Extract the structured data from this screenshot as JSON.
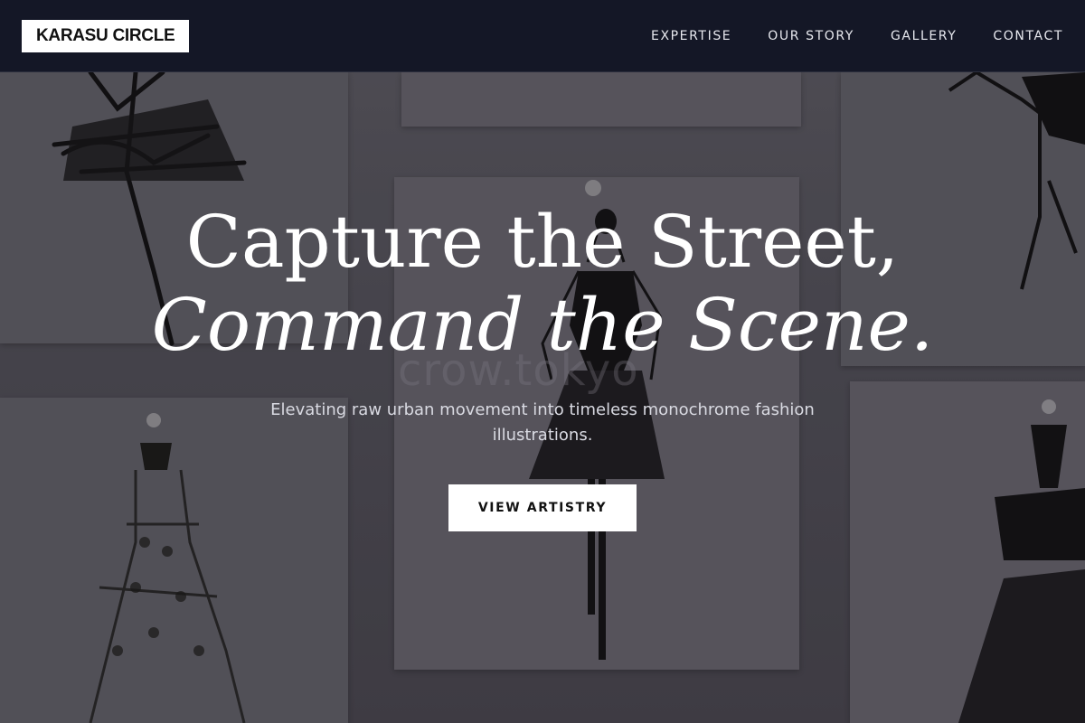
{
  "header": {
    "logo": "KARASU CIRCLE",
    "nav": [
      {
        "label": "EXPERTISE"
      },
      {
        "label": "OUR STORY"
      },
      {
        "label": "GALLERY"
      },
      {
        "label": "CONTACT"
      }
    ]
  },
  "hero": {
    "headline_line1": "Capture the Street,",
    "headline_line2": "Command the Scene.",
    "subtitle": "Elevating raw urban movement into timeless monochrome fashion illustrations.",
    "cta_label": "VIEW ARTISTRY"
  },
  "background": {
    "watermark": "crow.tokyo"
  },
  "colors": {
    "header_bg": "#141726",
    "accent": "#ffffff",
    "text_light": "#d9dae2"
  }
}
